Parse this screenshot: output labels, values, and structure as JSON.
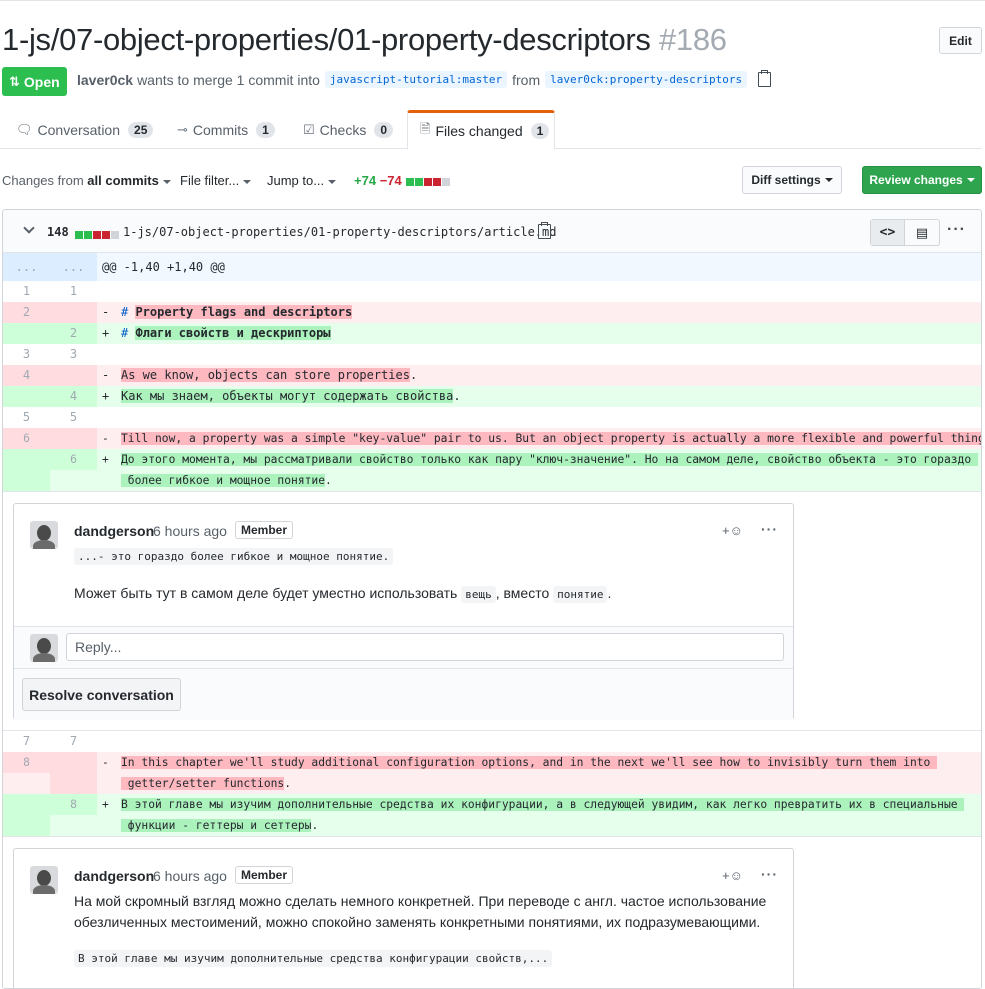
{
  "header": {
    "title": "1-js/07-object-properties/01-property-descriptors",
    "number": "#186",
    "edit_label": "Edit"
  },
  "state": {
    "label": "Open",
    "author": "laver0ck",
    "merge_text": "wants to merge 1 commit into",
    "base_branch": "javascript-tutorial:master",
    "from_text": "from",
    "head_branch": "laver0ck:property-descriptors"
  },
  "tabs": [
    {
      "label": "Conversation",
      "count": "25",
      "icon": "comment-discussion-icon"
    },
    {
      "label": "Commits",
      "count": "1",
      "icon": "git-commit-icon"
    },
    {
      "label": "Checks",
      "count": "0",
      "icon": "checklist-icon"
    },
    {
      "label": "Files changed",
      "count": "1",
      "icon": "file-diff-icon"
    }
  ],
  "toolbar": {
    "changes_prefix": "Changes from",
    "changes_value": "all commits",
    "file_filter": "File filter...",
    "jump_to": "Jump to...",
    "additions": "+74",
    "deletions": "−74",
    "diff_settings": "Diff settings",
    "review_changes": "Review changes"
  },
  "file": {
    "count": "148",
    "path": "1-js/07-object-properties/01-property-descriptors/article.md"
  },
  "diff": {
    "hunk": {
      "l1": "...",
      "l2": "...",
      "text": "@@ -1,40 +1,40 @@"
    },
    "rows": [
      {
        "l1": "1",
        "l2": "1",
        "sign": "",
        "text": ""
      },
      {
        "l1": "2",
        "l2": "",
        "sign": "-",
        "pre": "# ",
        "hl": "Property flags and descriptors",
        "post": ""
      },
      {
        "l1": "",
        "l2": "2",
        "sign": "+",
        "pre": "# ",
        "hl": "Флаги свойств и дескрипторы",
        "post": ""
      },
      {
        "l1": "3",
        "l2": "3",
        "sign": "",
        "text": ""
      },
      {
        "l1": "4",
        "l2": "",
        "sign": "-",
        "pre": "",
        "hl": "As we know, objects can store properties",
        "post": "."
      },
      {
        "l1": "",
        "l2": "4",
        "sign": "+",
        "pre": "",
        "hl": "Как мы знаем, объекты могут содержать свойства",
        "post": "."
      },
      {
        "l1": "5",
        "l2": "5",
        "sign": "",
        "text": ""
      },
      {
        "l1": "6",
        "l2": "",
        "sign": "-",
        "pre": "",
        "hl": "Till now, a property was a simple \"key-value\" pair to us. But an object property is actually a more flexible and powerful thing",
        "post": "."
      },
      {
        "l1": "",
        "l2": "6",
        "sign": "+",
        "line1": "До этого момента, мы рассматривали свойство только как пару \"ключ-значение\". Но на самом деле, свойство объекта - это гораздо ",
        "line2": " более гибкое и мощное понятие",
        "post": "."
      }
    ],
    "rows2": [
      {
        "l1": "7",
        "l2": "7",
        "sign": "",
        "text": ""
      },
      {
        "l1": "8",
        "l2": "",
        "sign": "-",
        "line1": "In this chapter we'll study additional configuration options, and in the next we'll see how to invisibly turn them into ",
        "line2": " getter/setter functions",
        "post": "."
      },
      {
        "l1": "",
        "l2": "8",
        "sign": "+",
        "line1": "В этой главе мы изучим дополнительные средства их конфигурации, а в следующей увидим, как легко превратить их в специальные ",
        "line2": " функции - геттеры и сеттеры",
        "post": "."
      }
    ]
  },
  "comment1": {
    "author": "dandgerson",
    "time": "6 hours ago",
    "badge": "Member",
    "react": "+☺",
    "quote": "...- это гораздо более гибкое и мощное понятие.",
    "text_pre": "Может быть тут в самом деле будет уместно использовать",
    "code1": "вещь",
    "text_mid": ", вместо",
    "code2": "понятие",
    "text_post": ".",
    "reply_placeholder": "Reply...",
    "resolve_label": "Resolve conversation"
  },
  "comment2": {
    "author": "dandgerson",
    "time": "6 hours ago",
    "badge": "Member",
    "react": "+☺",
    "text": "На мой скромный взгляд можно сделать немного конкретней. При переводе с англ. частое использование обезличенных местоимений, можно спокойно заменять конкретными понятиями, их подразумевающими.",
    "quote": "В этой главе мы изучим дополнительные средства конфигурации свойств,..."
  },
  "colors": {
    "open_green": "#2cbe4e",
    "review_green": "#2ea44f",
    "del_bg": "#ffeef0",
    "add_bg": "#e6ffed",
    "tab_accent": "#e36209"
  }
}
